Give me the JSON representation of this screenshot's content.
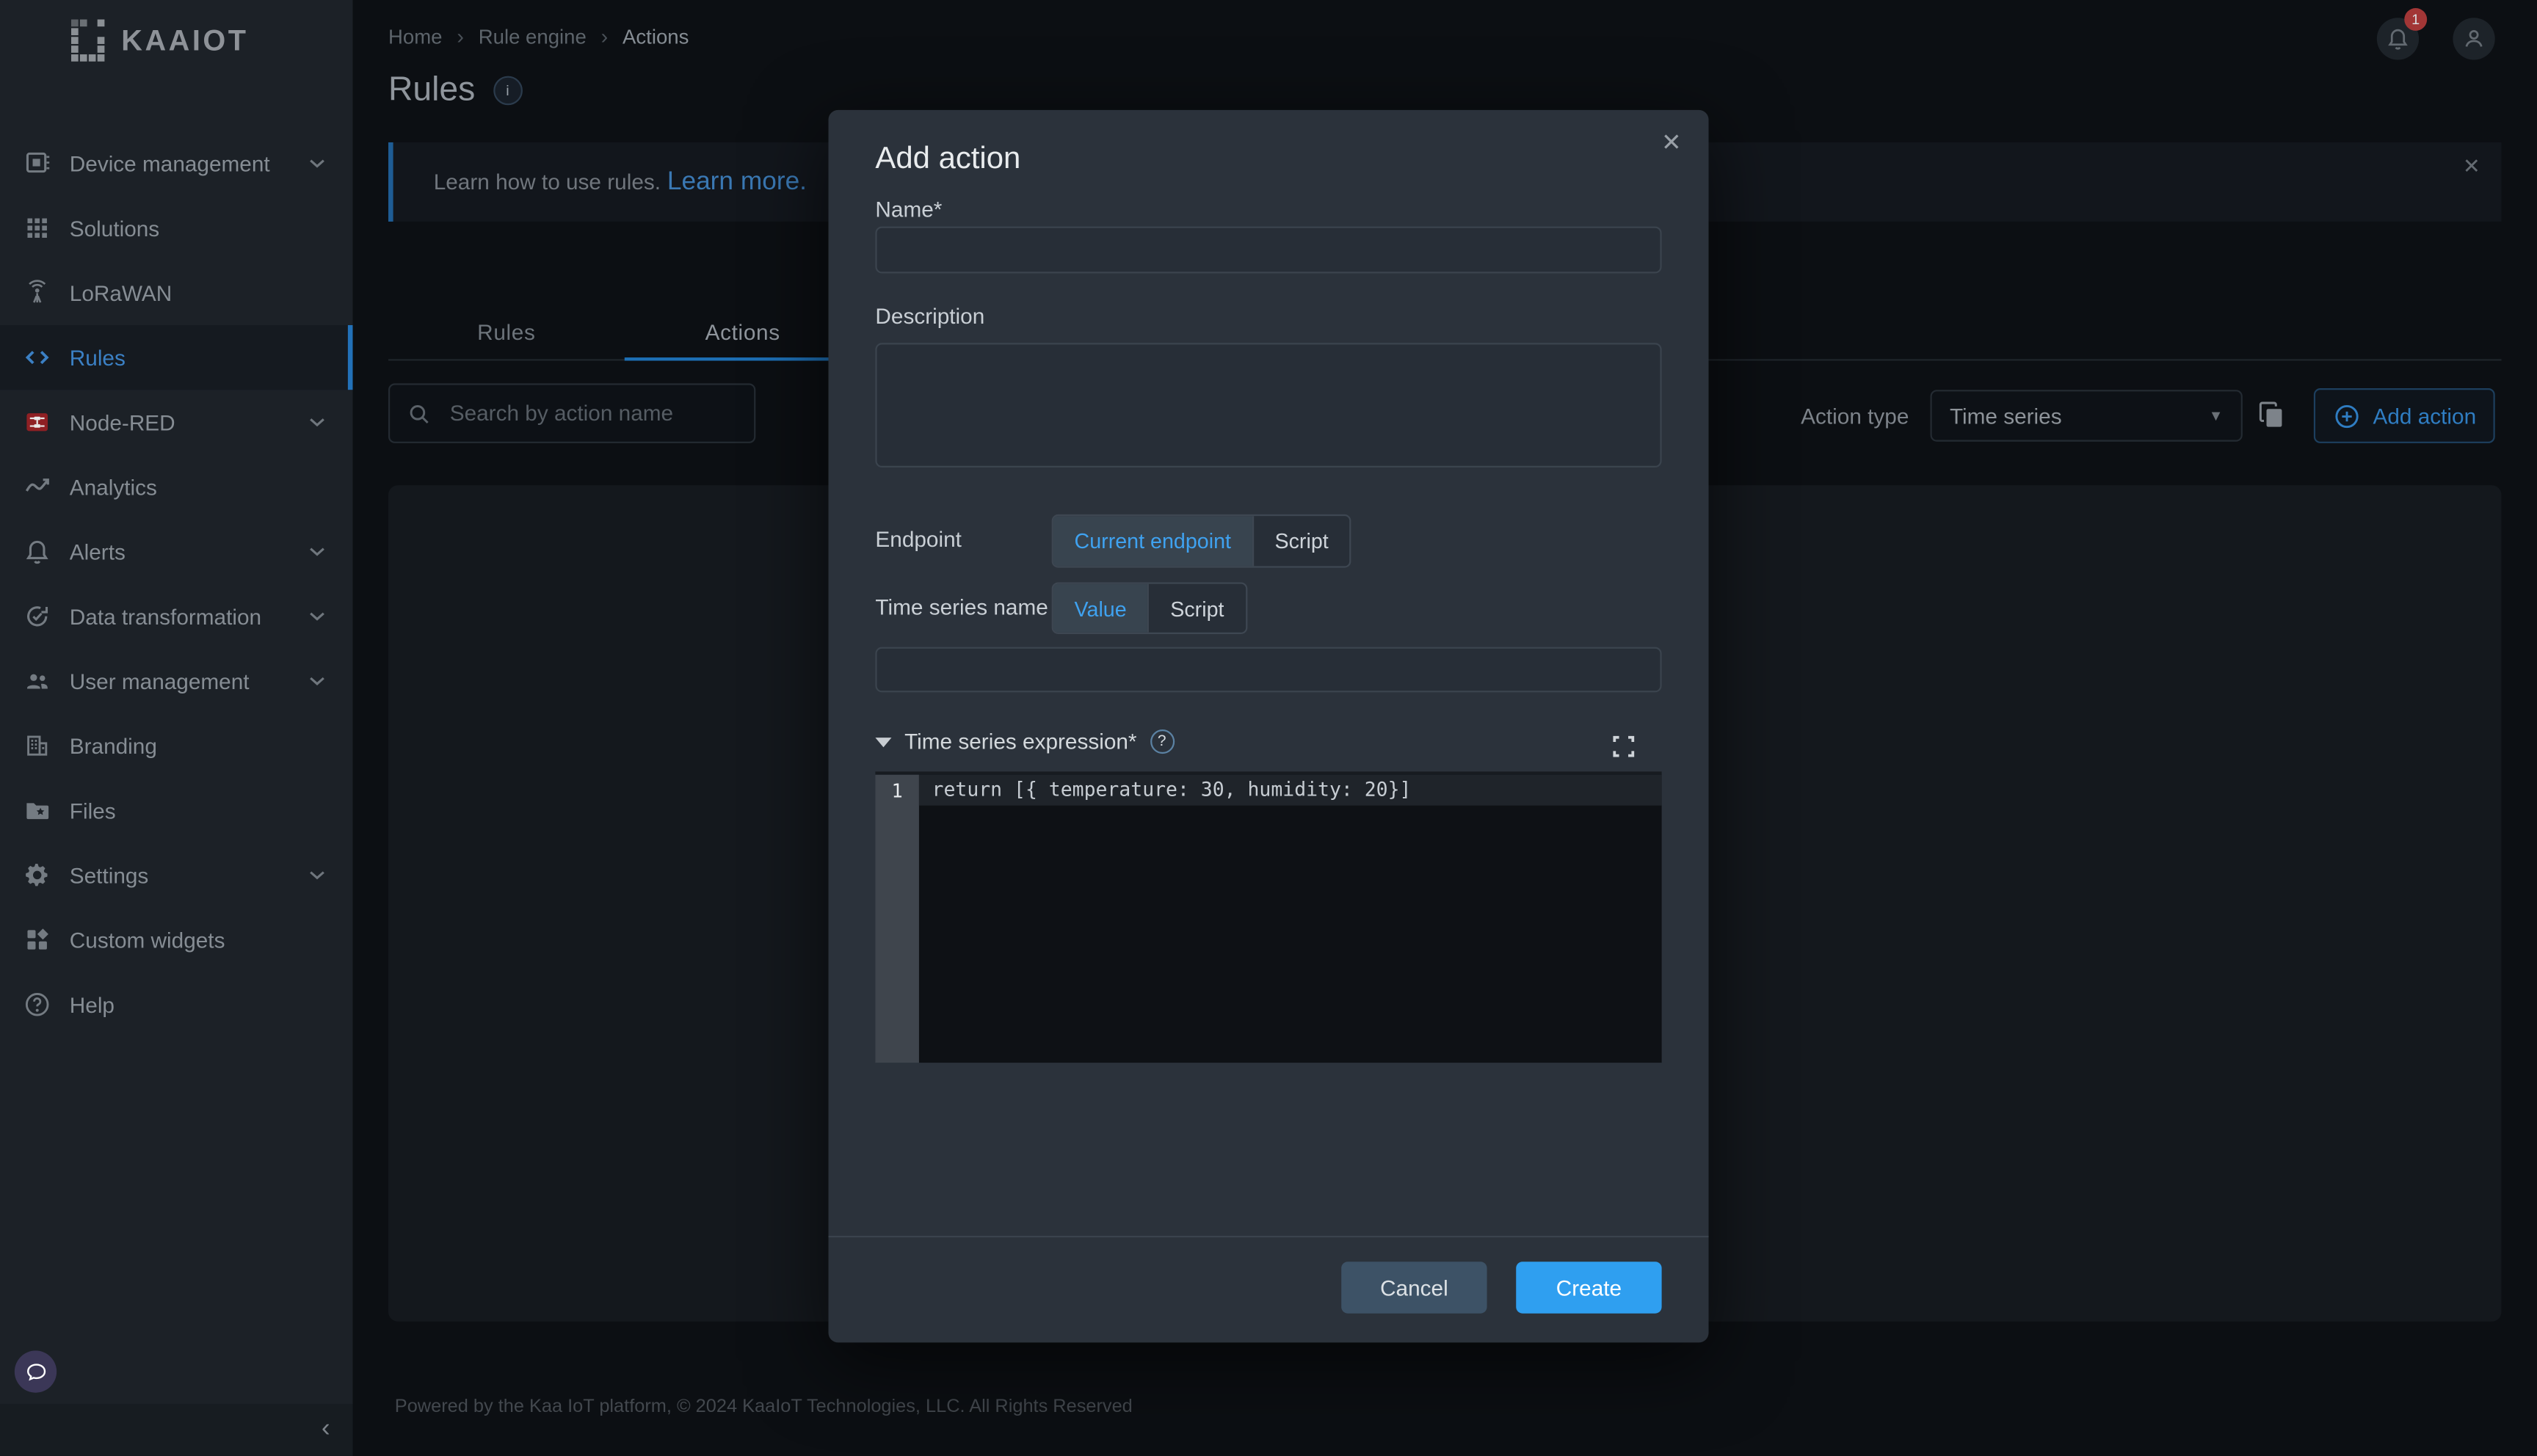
{
  "sidebar": {
    "logo_text": "KAAIOT",
    "items": [
      {
        "label": "Device management",
        "icon": "chip-icon",
        "chevron": true,
        "active": false
      },
      {
        "label": "Solutions",
        "icon": "grid-icon",
        "chevron": false,
        "active": false
      },
      {
        "label": "LoRaWAN",
        "icon": "antenna-icon",
        "chevron": false,
        "active": false
      },
      {
        "label": "Rules",
        "icon": "code-icon",
        "chevron": false,
        "active": true
      },
      {
        "label": "Node-RED",
        "icon": "node-red-icon",
        "chevron": true,
        "active": false
      },
      {
        "label": "Analytics",
        "icon": "chart-icon",
        "chevron": false,
        "active": false
      },
      {
        "label": "Alerts",
        "icon": "bell-icon",
        "chevron": true,
        "active": false
      },
      {
        "label": "Data transformation",
        "icon": "sync-icon",
        "chevron": true,
        "active": false
      },
      {
        "label": "User management",
        "icon": "people-icon",
        "chevron": true,
        "active": false
      },
      {
        "label": "Branding",
        "icon": "building-icon",
        "chevron": false,
        "active": false
      },
      {
        "label": "Files",
        "icon": "folder-icon",
        "chevron": false,
        "active": false
      },
      {
        "label": "Settings",
        "icon": "gear-icon",
        "chevron": true,
        "active": false
      },
      {
        "label": "Custom widgets",
        "icon": "widgets-icon",
        "chevron": false,
        "active": false
      },
      {
        "label": "Help",
        "icon": "help-icon",
        "chevron": false,
        "active": false
      }
    ],
    "collapse_glyph": "‹"
  },
  "header": {
    "breadcrumb": [
      "Home",
      "Rule engine",
      "Actions"
    ],
    "notification_count": "1"
  },
  "page": {
    "title": "Rules",
    "info_glyph": "i",
    "banner": {
      "text": "Learn how to use rules.",
      "link": "Learn more.",
      "close_glyph": "✕"
    },
    "tabs": [
      {
        "label": "Rules",
        "active": false
      },
      {
        "label": "Actions",
        "active": true
      }
    ],
    "search_placeholder": "Search by action name",
    "action_type_label": "Action type",
    "action_type_value": "Time series",
    "add_action_label": "Add action",
    "footer": "Powered by the Kaa IoT platform, © 2024 KaaIoT Technologies, LLC. All Rights Reserved"
  },
  "modal": {
    "title": "Add action",
    "close_glyph": "✕",
    "name_label": "Name*",
    "name_value": "",
    "description_label": "Description",
    "description_value": "",
    "endpoint_label": "Endpoint",
    "endpoint_options": [
      "Current endpoint",
      "Script"
    ],
    "endpoint_selected": "Current endpoint",
    "ts_name_label": "Time series name",
    "ts_name_options": [
      "Value",
      "Script"
    ],
    "ts_name_selected": "Value",
    "ts_value": "",
    "expression_label": "Time series expression*",
    "expression_help_glyph": "?",
    "code": {
      "line_number": "1",
      "line_text": "return [{ temperature: 30, humidity: 20}]"
    },
    "cancel_label": "Cancel",
    "create_label": "Create"
  },
  "colors": {
    "accent_blue": "#2f9ff0",
    "sidebar_active_blue": "#3b80c4",
    "link_blue": "#3a78b3",
    "badge_red": "#a23636",
    "node_red_brand": "#8f2024",
    "modal_bg": "#2b323b",
    "page_bg": "#0c0f13",
    "sidebar_bg": "#1c2127"
  }
}
